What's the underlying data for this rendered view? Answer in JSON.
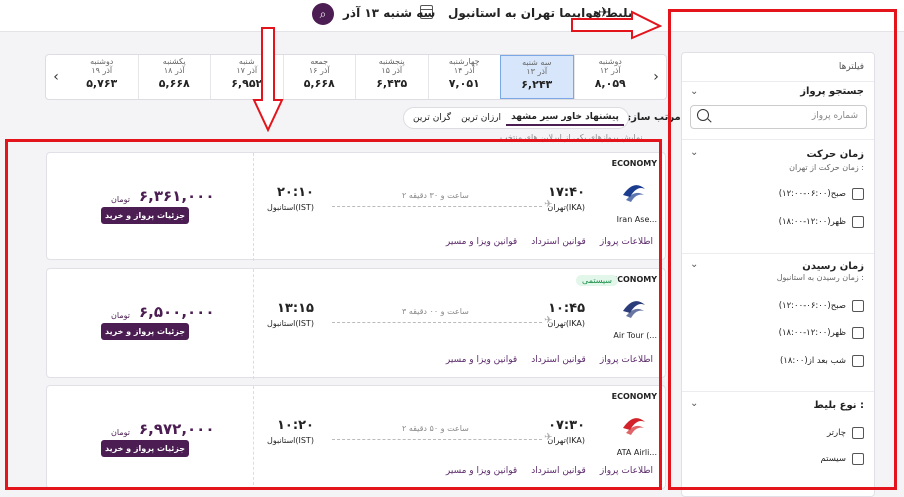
{
  "header": {
    "route": "بلیط هواپیما تهران به استانبول",
    "date": "سه شنبه ۱۳ آذر"
  },
  "date_bar": {
    "days": [
      {
        "day": "دوشنبه",
        "date": "۱۹ آذر",
        "price": "۵,۷۶۳"
      },
      {
        "day": "یکشنبه",
        "date": "۱۸ آذر",
        "price": "۵,۶۶۸"
      },
      {
        "day": "شنبه",
        "date": "۱۷ آذر",
        "price": "۶,۹۵۲"
      },
      {
        "day": "جمعه",
        "date": "۱۶ آذر",
        "price": "۵,۶۶۸"
      },
      {
        "day": "پنجشنبه",
        "date": "۱۵ آذر",
        "price": "۶,۴۳۵"
      },
      {
        "day": "چهارشنبه",
        "date": "۱۴ آذر",
        "price": "۷,۰۵۱"
      },
      {
        "day": "سه شنبه",
        "date": "۱۳ آذر",
        "price": "۶,۲۴۳"
      },
      {
        "day": "دوشنبه",
        "date": "۱۲ آذر",
        "price": "۸,۰۵۹"
      }
    ]
  },
  "sort": {
    "label": "مرتب سازی :",
    "options": [
      "پیشنهاد خاور سیر مشهد",
      "ارزان ترین",
      "گران ترین"
    ],
    "note": "نمایش پروازهای یکی از ایرلاین های منتخب"
  },
  "flights": [
    {
      "class": "ECONOMY",
      "badge": "",
      "airline": "Iran Ase...",
      "dep_time": "۱۷:۴۰",
      "dep_airport": "تهران(IKA)",
      "arr_time": "۲۰:۱۰",
      "arr_airport": "استانبول(IST)",
      "duration": "۲ ساعت و ۳۰ دقیقه",
      "price": "۶,۳۶۱,۰۰۰",
      "currency": "تومان",
      "button": "جزئیات پرواز و خرید",
      "links": [
        "اطلاعات پرواز",
        "قوانین استرداد",
        "قوانین ویزا و مسیر"
      ],
      "logo_color": "#1b3d8f"
    },
    {
      "class": "ECONOMY",
      "badge": "سیستمی",
      "airline": "Air Tour (...",
      "dep_time": "۱۰:۴۵",
      "dep_airport": "تهران(IKA)",
      "arr_time": "۱۳:۱۵",
      "arr_airport": "استانبول(IST)",
      "duration": "۳ ساعت و ۰۰ دقیقه",
      "price": "۶,۵۰۰,۰۰۰",
      "currency": "تومان",
      "button": "جزئیات پرواز و خرید",
      "links": [
        "اطلاعات پرواز",
        "قوانین استرداد",
        "قوانین ویزا و مسیر"
      ],
      "logo_color": "#2a3c7a"
    },
    {
      "class": "ECONOMY",
      "badge": "",
      "airline": "ATA Airli...",
      "dep_time": "۰۷:۳۰",
      "dep_airport": "تهران(IKA)",
      "arr_time": "۱۰:۲۰",
      "arr_airport": "استانبول(IST)",
      "duration": "۲ ساعت و ۵۰ دقیقه",
      "price": "۶,۹۷۲,۰۰۰",
      "currency": "تومان",
      "button": "جزئیات پرواز و خرید",
      "links": [
        "اطلاعات پرواز",
        "قوانین استرداد",
        "قوانین ویزا و مسیر"
      ],
      "logo_color": "#d2232a"
    }
  ],
  "sidebar": {
    "title": "فیلترها",
    "search_title": "جستجو پرواز",
    "search_placeholder": "شماره پرواز",
    "departure": {
      "title": "زمان حرکت",
      "sub": "زمان حرکت از تهران :",
      "options": [
        "صبح(۰۶:۰۰-۱۲:۰۰)",
        "ظهر(۱۲:۰۰-۱۸:۰۰)"
      ]
    },
    "arrival": {
      "title": "زمان رسیدن",
      "sub": "زمان رسیدن به استانبول :",
      "options": [
        "صبح(۰۶:۰۰-۱۲:۰۰)",
        "ظهر(۱۲:۰۰-۱۸:۰۰)",
        "شب بعد از(۱۸:۰۰)"
      ]
    },
    "ticket_type": {
      "title": "نوع بلیط :",
      "options": [
        "چارتر",
        "سیستم"
      ]
    }
  },
  "colors": {
    "brand": "#4b1d52",
    "annotation": "#e3141c",
    "selected_date": "#d7e6fb"
  }
}
